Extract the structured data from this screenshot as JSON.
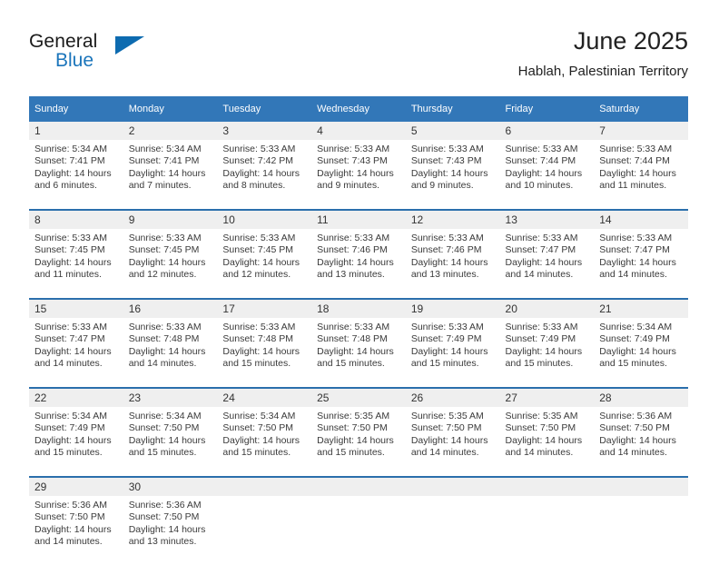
{
  "logo": {
    "word_one": "General",
    "word_two": "Blue",
    "triangle_color": "#0d6bb0",
    "text_color": "#1b75bb"
  },
  "header": {
    "title": "June 2025",
    "subtitle": "Hablah, Palestinian Territory"
  },
  "theme": {
    "header_bg": "#3277b8",
    "daynum_bg": "#efefef",
    "week_divider": "#2b6fac",
    "body_text": "#3a3a3a"
  },
  "columns": [
    "Sunday",
    "Monday",
    "Tuesday",
    "Wednesday",
    "Thursday",
    "Friday",
    "Saturday"
  ],
  "weeks": [
    {
      "days": [
        {
          "num": "1",
          "l1": "Sunrise: 5:34 AM",
          "l2": "Sunset: 7:41 PM",
          "l3": "Daylight: 14 hours",
          "l4": "and 6 minutes."
        },
        {
          "num": "2",
          "l1": "Sunrise: 5:34 AM",
          "l2": "Sunset: 7:41 PM",
          "l3": "Daylight: 14 hours",
          "l4": "and 7 minutes."
        },
        {
          "num": "3",
          "l1": "Sunrise: 5:33 AM",
          "l2": "Sunset: 7:42 PM",
          "l3": "Daylight: 14 hours",
          "l4": "and 8 minutes."
        },
        {
          "num": "4",
          "l1": "Sunrise: 5:33 AM",
          "l2": "Sunset: 7:43 PM",
          "l3": "Daylight: 14 hours",
          "l4": "and 9 minutes."
        },
        {
          "num": "5",
          "l1": "Sunrise: 5:33 AM",
          "l2": "Sunset: 7:43 PM",
          "l3": "Daylight: 14 hours",
          "l4": "and 9 minutes."
        },
        {
          "num": "6",
          "l1": "Sunrise: 5:33 AM",
          "l2": "Sunset: 7:44 PM",
          "l3": "Daylight: 14 hours",
          "l4": "and 10 minutes."
        },
        {
          "num": "7",
          "l1": "Sunrise: 5:33 AM",
          "l2": "Sunset: 7:44 PM",
          "l3": "Daylight: 14 hours",
          "l4": "and 11 minutes."
        }
      ]
    },
    {
      "days": [
        {
          "num": "8",
          "l1": "Sunrise: 5:33 AM",
          "l2": "Sunset: 7:45 PM",
          "l3": "Daylight: 14 hours",
          "l4": "and 11 minutes."
        },
        {
          "num": "9",
          "l1": "Sunrise: 5:33 AM",
          "l2": "Sunset: 7:45 PM",
          "l3": "Daylight: 14 hours",
          "l4": "and 12 minutes."
        },
        {
          "num": "10",
          "l1": "Sunrise: 5:33 AM",
          "l2": "Sunset: 7:45 PM",
          "l3": "Daylight: 14 hours",
          "l4": "and 12 minutes."
        },
        {
          "num": "11",
          "l1": "Sunrise: 5:33 AM",
          "l2": "Sunset: 7:46 PM",
          "l3": "Daylight: 14 hours",
          "l4": "and 13 minutes."
        },
        {
          "num": "12",
          "l1": "Sunrise: 5:33 AM",
          "l2": "Sunset: 7:46 PM",
          "l3": "Daylight: 14 hours",
          "l4": "and 13 minutes."
        },
        {
          "num": "13",
          "l1": "Sunrise: 5:33 AM",
          "l2": "Sunset: 7:47 PM",
          "l3": "Daylight: 14 hours",
          "l4": "and 14 minutes."
        },
        {
          "num": "14",
          "l1": "Sunrise: 5:33 AM",
          "l2": "Sunset: 7:47 PM",
          "l3": "Daylight: 14 hours",
          "l4": "and 14 minutes."
        }
      ]
    },
    {
      "days": [
        {
          "num": "15",
          "l1": "Sunrise: 5:33 AM",
          "l2": "Sunset: 7:47 PM",
          "l3": "Daylight: 14 hours",
          "l4": "and 14 minutes."
        },
        {
          "num": "16",
          "l1": "Sunrise: 5:33 AM",
          "l2": "Sunset: 7:48 PM",
          "l3": "Daylight: 14 hours",
          "l4": "and 14 minutes."
        },
        {
          "num": "17",
          "l1": "Sunrise: 5:33 AM",
          "l2": "Sunset: 7:48 PM",
          "l3": "Daylight: 14 hours",
          "l4": "and 15 minutes."
        },
        {
          "num": "18",
          "l1": "Sunrise: 5:33 AM",
          "l2": "Sunset: 7:48 PM",
          "l3": "Daylight: 14 hours",
          "l4": "and 15 minutes."
        },
        {
          "num": "19",
          "l1": "Sunrise: 5:33 AM",
          "l2": "Sunset: 7:49 PM",
          "l3": "Daylight: 14 hours",
          "l4": "and 15 minutes."
        },
        {
          "num": "20",
          "l1": "Sunrise: 5:33 AM",
          "l2": "Sunset: 7:49 PM",
          "l3": "Daylight: 14 hours",
          "l4": "and 15 minutes."
        },
        {
          "num": "21",
          "l1": "Sunrise: 5:34 AM",
          "l2": "Sunset: 7:49 PM",
          "l3": "Daylight: 14 hours",
          "l4": "and 15 minutes."
        }
      ]
    },
    {
      "days": [
        {
          "num": "22",
          "l1": "Sunrise: 5:34 AM",
          "l2": "Sunset: 7:49 PM",
          "l3": "Daylight: 14 hours",
          "l4": "and 15 minutes."
        },
        {
          "num": "23",
          "l1": "Sunrise: 5:34 AM",
          "l2": "Sunset: 7:50 PM",
          "l3": "Daylight: 14 hours",
          "l4": "and 15 minutes."
        },
        {
          "num": "24",
          "l1": "Sunrise: 5:34 AM",
          "l2": "Sunset: 7:50 PM",
          "l3": "Daylight: 14 hours",
          "l4": "and 15 minutes."
        },
        {
          "num": "25",
          "l1": "Sunrise: 5:35 AM",
          "l2": "Sunset: 7:50 PM",
          "l3": "Daylight: 14 hours",
          "l4": "and 15 minutes."
        },
        {
          "num": "26",
          "l1": "Sunrise: 5:35 AM",
          "l2": "Sunset: 7:50 PM",
          "l3": "Daylight: 14 hours",
          "l4": "and 14 minutes."
        },
        {
          "num": "27",
          "l1": "Sunrise: 5:35 AM",
          "l2": "Sunset: 7:50 PM",
          "l3": "Daylight: 14 hours",
          "l4": "and 14 minutes."
        },
        {
          "num": "28",
          "l1": "Sunrise: 5:36 AM",
          "l2": "Sunset: 7:50 PM",
          "l3": "Daylight: 14 hours",
          "l4": "and 14 minutes."
        }
      ]
    },
    {
      "days": [
        {
          "num": "29",
          "l1": "Sunrise: 5:36 AM",
          "l2": "Sunset: 7:50 PM",
          "l3": "Daylight: 14 hours",
          "l4": "and 14 minutes."
        },
        {
          "num": "30",
          "l1": "Sunrise: 5:36 AM",
          "l2": "Sunset: 7:50 PM",
          "l3": "Daylight: 14 hours",
          "l4": "and 13 minutes."
        },
        {
          "num": "",
          "l1": "",
          "l2": "",
          "l3": "",
          "l4": ""
        },
        {
          "num": "",
          "l1": "",
          "l2": "",
          "l3": "",
          "l4": ""
        },
        {
          "num": "",
          "l1": "",
          "l2": "",
          "l3": "",
          "l4": ""
        },
        {
          "num": "",
          "l1": "",
          "l2": "",
          "l3": "",
          "l4": ""
        },
        {
          "num": "",
          "l1": "",
          "l2": "",
          "l3": "",
          "l4": ""
        }
      ]
    }
  ]
}
